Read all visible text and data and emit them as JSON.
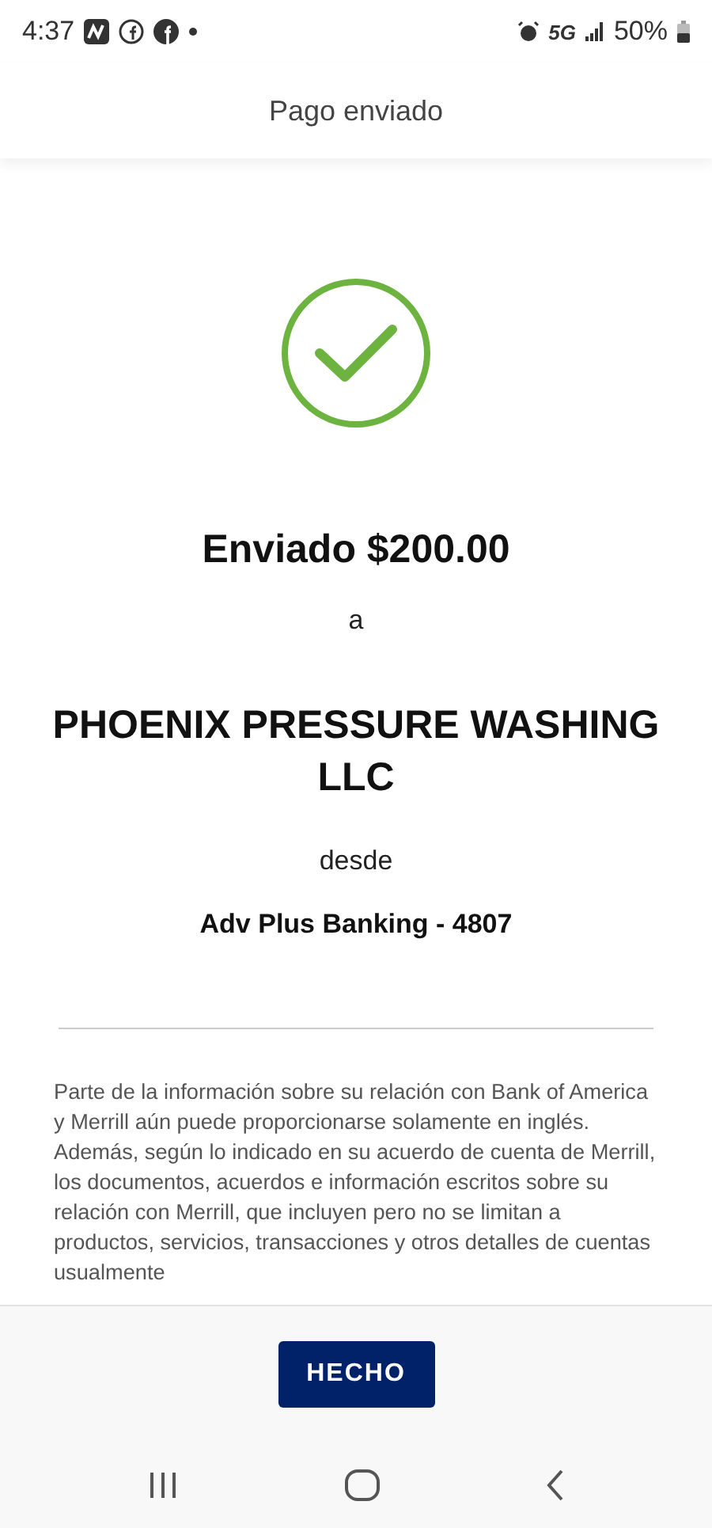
{
  "status_bar": {
    "time": "4:37",
    "network": "5G",
    "battery": "50%"
  },
  "header": {
    "title": "Pago enviado"
  },
  "confirmation": {
    "amount_line": "Enviado $200.00",
    "to_label": "a",
    "recipient": "PHOENIX PRESSURE WASHING LLC",
    "from_label": "desde",
    "account": "Adv Plus Banking - 4807"
  },
  "disclaimer": "Parte de la información sobre su relación con Bank of America y Merrill aún puede proporcionarse solamente en inglés. Además, según lo indicado en su acuerdo de cuenta de Merrill, los documentos, acuerdos e información escritos sobre su relación con Merrill, que incluyen pero no se limitan a productos, servicios, transacciones y otros detalles de cuentas usualmente",
  "done_button": "HECHO"
}
